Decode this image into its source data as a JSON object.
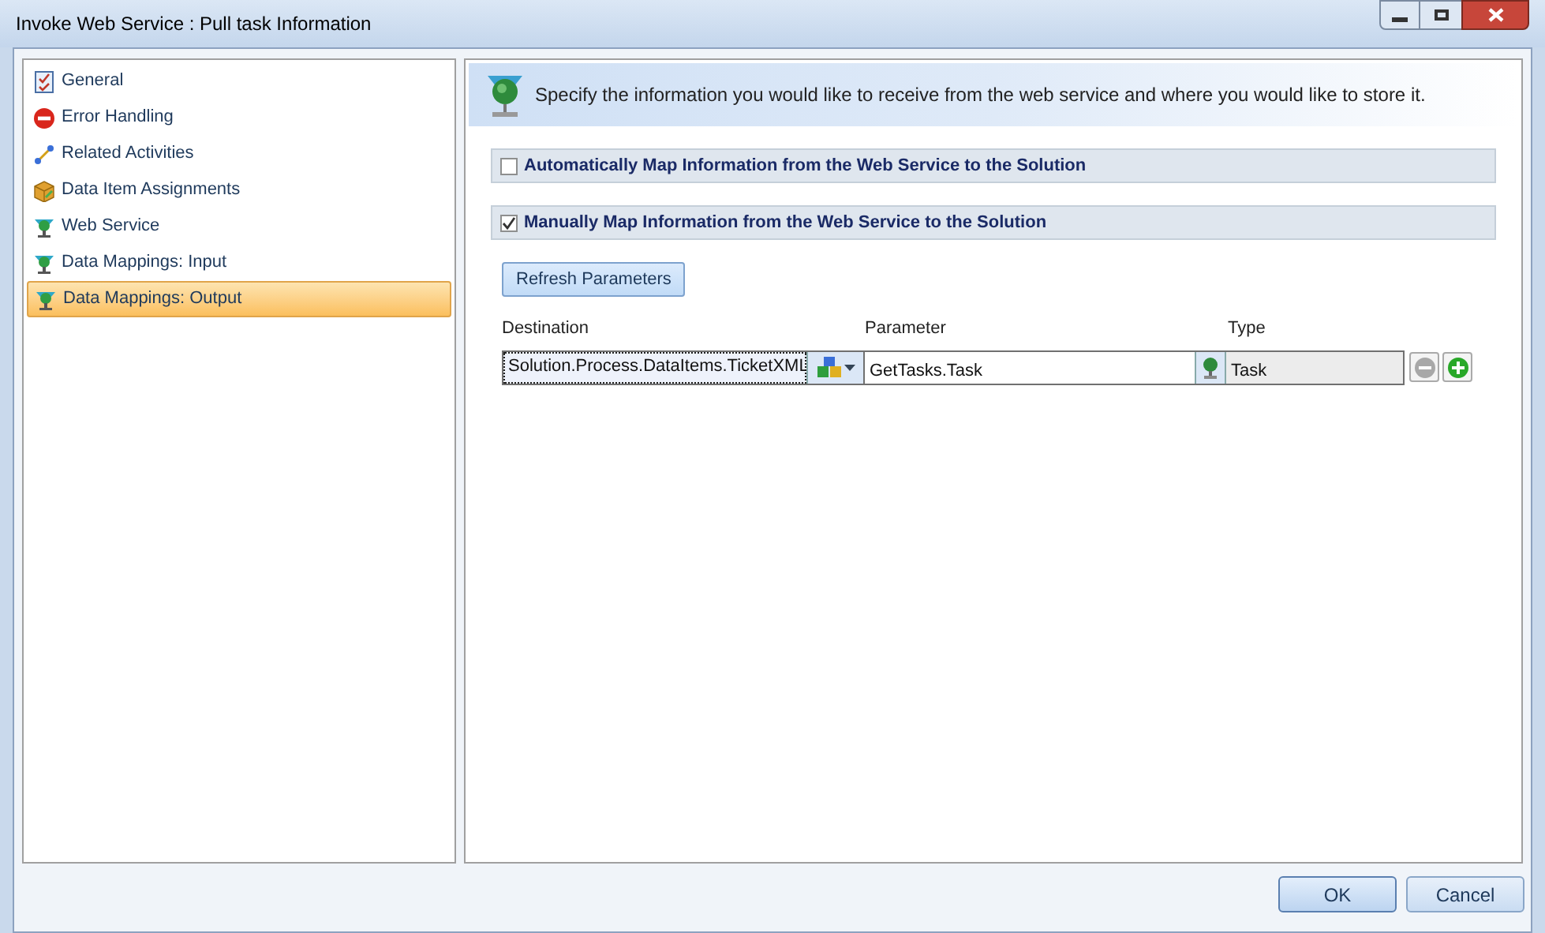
{
  "window": {
    "title": "Invoke Web Service : Pull task Information"
  },
  "sidebar": {
    "items": [
      {
        "label": "General",
        "kind": "checklist",
        "selected": false
      },
      {
        "label": "Error Handling",
        "kind": "error",
        "selected": false
      },
      {
        "label": "Related Activities",
        "kind": "link",
        "selected": false
      },
      {
        "label": "Data Item Assignments",
        "kind": "box",
        "selected": false
      },
      {
        "label": "Web Service",
        "kind": "service",
        "selected": false
      },
      {
        "label": "Data Mappings: Input",
        "kind": "service",
        "selected": false
      },
      {
        "label": "Data Mappings: Output",
        "kind": "service",
        "selected": true
      }
    ]
  },
  "header": {
    "text": "Specify the information you would like to receive from the web service and where you would like to store it."
  },
  "options": [
    {
      "label": "Automatically Map Information from the Web Service to the Solution",
      "checked": false
    },
    {
      "label": "Manually Map Information from the Web Service to the Solution",
      "checked": true
    }
  ],
  "refresh_button": "Refresh Parameters",
  "table": {
    "columns": [
      "Destination",
      "Parameter",
      "Type"
    ],
    "rows": [
      {
        "destination": "Solution.Process.DataItems.TicketXML",
        "parameter": "GetTasks.Task",
        "type": "Task"
      }
    ]
  },
  "buttons": [
    "OK",
    "Cancel"
  ]
}
